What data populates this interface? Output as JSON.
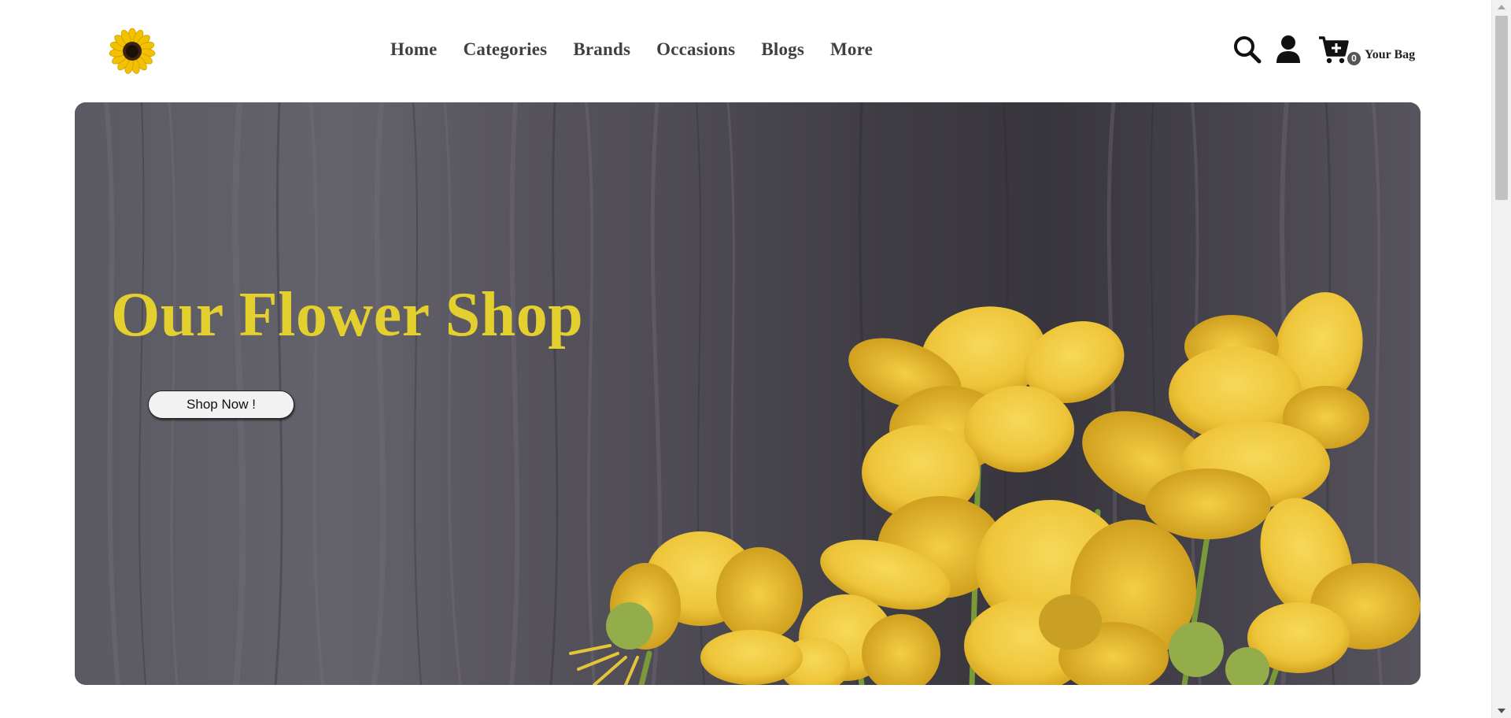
{
  "header": {
    "logo_icon": "sunflower-icon",
    "nav": [
      {
        "label": "Home"
      },
      {
        "label": "Categories"
      },
      {
        "label": "Brands"
      },
      {
        "label": "Occasions"
      },
      {
        "label": "Blogs"
      },
      {
        "label": "More"
      }
    ],
    "icons": {
      "search": "search-icon",
      "account": "user-icon",
      "cart": "cart-plus-icon"
    },
    "cart": {
      "count": "0",
      "label": "Your Bag"
    }
  },
  "hero": {
    "title": "Our Flower Shop",
    "button_label": "Shop Now !",
    "title_color": "#e3cf2e",
    "background": "dark wood with yellow buttercup flowers"
  }
}
